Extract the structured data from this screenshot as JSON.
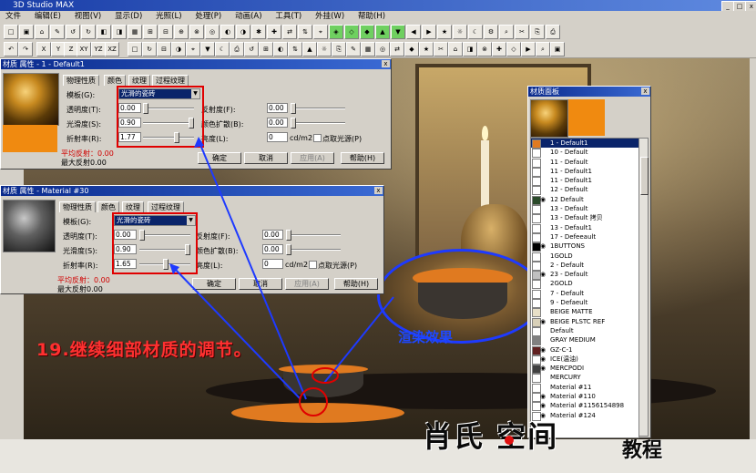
{
  "window": {
    "title": "3D Studio MAX"
  },
  "menu": [
    "文件",
    "编辑(E)",
    "视图(V)",
    "显示(D)",
    "光照(L)",
    "处理(P)",
    "动画(A)",
    "工具(T)",
    "外挂(W)",
    "帮助(H)"
  ],
  "toolbar2_letters": [
    "X",
    "Y",
    "Z",
    "XY",
    "YZ",
    "XZ"
  ],
  "dialog1": {
    "title": "材质 属性 - 1 - Default1",
    "tabs": [
      "物理性质",
      "颜色",
      "纹理",
      "过程纹理"
    ],
    "template_label": "模板(G):",
    "template_value": "光滑的瓷砖",
    "transparency_label": "透明度(T):",
    "transparency_value": "0.00",
    "smoothness_label": "光滑度(S):",
    "smoothness_value": "0.90",
    "refraction_label": "折射率(R):",
    "refraction_value": "1.77",
    "reflection_label": "反射度(F):",
    "reflection_value": "0.00",
    "color_spread_label": "颜色扩散(B):",
    "color_spread_value": "0.00",
    "brightness_label": "亮度(L):",
    "brightness_value": "0",
    "brightness_unit": "cd/m2",
    "point_light_label": "点取光源(P)",
    "avg_reflect": "平均反射：0.00",
    "max_reflect": "最大反射0.00",
    "ok": "确定",
    "cancel": "取消",
    "apply": "应用(A)",
    "help": "帮助(H)"
  },
  "dialog2": {
    "title": "材质 属性 - Material #30",
    "tabs": [
      "物理性质",
      "颜色",
      "纹理",
      "过程纹理"
    ],
    "template_label": "模板(G):",
    "template_value": "光滑的瓷砖",
    "transparency_label": "透明度(T):",
    "transparency_value": "0.00",
    "smoothness_label": "光滑度(S):",
    "smoothness_value": "0.90",
    "refraction_label": "折射率(R):",
    "refraction_value": "1.65",
    "reflection_label": "反射度(F):",
    "reflection_value": "0.00",
    "color_spread_label": "颜色扩散(B):",
    "color_spread_value": "0.00",
    "brightness_label": "亮度(L):",
    "brightness_value": "0",
    "brightness_unit": "cd/m2",
    "point_light_label": "点取光源(P)",
    "avg_reflect": "平均反射：0.00",
    "max_reflect": "最大反射0.00",
    "ok": "确定",
    "cancel": "取消",
    "apply": "应用(A)",
    "help": "帮助(H)"
  },
  "material_panel": {
    "title": "材质面板",
    "items": [
      {
        "name": "1 - Default1",
        "color": "#e07a20",
        "globe": false,
        "selected": true
      },
      {
        "name": "10 - Default",
        "color": "#ffffff",
        "globe": false
      },
      {
        "name": "11 - Default",
        "color": "#ffffff",
        "globe": false
      },
      {
        "name": "11 - Default1",
        "color": "#ffffff",
        "globe": false
      },
      {
        "name": "11 - Default1",
        "color": "#ffffff",
        "globe": false
      },
      {
        "name": "12 - Default",
        "color": "#ffffff",
        "globe": false
      },
      {
        "name": "12 Default",
        "color": "#2a4a2a",
        "globe": true
      },
      {
        "name": "13 - Default",
        "color": "#ffffff",
        "globe": false
      },
      {
        "name": "13 - Default 拷贝",
        "color": "#ffffff",
        "globe": false
      },
      {
        "name": "13 - Default1",
        "color": "#ffffff",
        "globe": false
      },
      {
        "name": "17 - Defeeault",
        "color": "#ffffff",
        "globe": false
      },
      {
        "name": "1BUTTONS",
        "color": "#000000",
        "globe": true
      },
      {
        "name": "1GOLD",
        "color": "#ffffff",
        "globe": false
      },
      {
        "name": "2 - Default",
        "color": "#ffffff",
        "globe": false
      },
      {
        "name": "23 - Default",
        "color": "#c0c0c0",
        "globe": true
      },
      {
        "name": "2GOLD",
        "color": "#ffffff",
        "globe": false
      },
      {
        "name": "7 - Default",
        "color": "#ffffff",
        "globe": false
      },
      {
        "name": "9 - Defaeult",
        "color": "#ffffff",
        "globe": false
      },
      {
        "name": "BEIGE MATTE",
        "color": "#e8e0c8",
        "globe": false
      },
      {
        "name": "BEIGE PLSTC REF",
        "color": "#d8d0b8",
        "globe": true
      },
      {
        "name": "Default",
        "color": "#ffffff",
        "globe": false
      },
      {
        "name": "GRAY MEDIUM",
        "color": "#808080",
        "globe": false
      },
      {
        "name": "GZ-C-1",
        "color": "#602020",
        "globe": true
      },
      {
        "name": "ICE(温油)",
        "color": "#ffffff",
        "globe": true
      },
      {
        "name": "MERCPODI",
        "color": "#404040",
        "globe": true
      },
      {
        "name": "MERCURY",
        "color": "#ffffff",
        "globe": false
      },
      {
        "name": "Material #11",
        "color": "#ffffff",
        "globe": false
      },
      {
        "name": "Material #110",
        "color": "#ffffff",
        "globe": true
      },
      {
        "name": "Material #1156154898",
        "color": "#ffffff",
        "globe": true
      },
      {
        "name": "Material #124",
        "color": "#ffffff",
        "globe": true
      }
    ]
  },
  "annotations": {
    "caption": "19.继续细部材质的调节。",
    "render_label": "渲染效果",
    "brand_main": "肖氏 空间",
    "brand_sub": "教程"
  },
  "colors": {
    "annotation_red": "#ff3030",
    "annotation_blue": "#1e48ff",
    "title_blue": "#0a2a8c"
  }
}
